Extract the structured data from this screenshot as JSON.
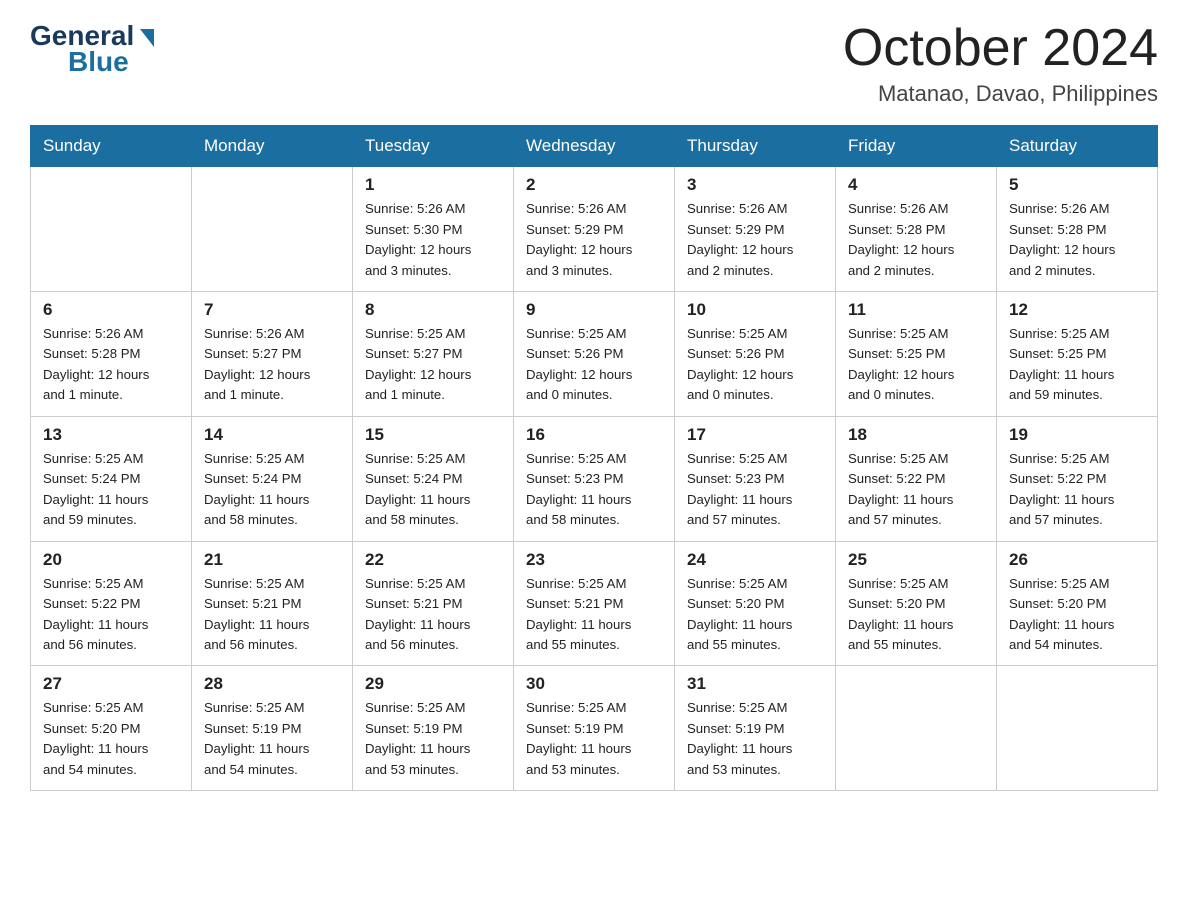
{
  "header": {
    "logo": {
      "general": "General",
      "blue": "Blue"
    },
    "title": "October 2024",
    "location": "Matanao, Davao, Philippines"
  },
  "weekdays": [
    "Sunday",
    "Monday",
    "Tuesday",
    "Wednesday",
    "Thursday",
    "Friday",
    "Saturday"
  ],
  "weeks": [
    [
      {
        "day": "",
        "info": ""
      },
      {
        "day": "",
        "info": ""
      },
      {
        "day": "1",
        "info": "Sunrise: 5:26 AM\nSunset: 5:30 PM\nDaylight: 12 hours\nand 3 minutes."
      },
      {
        "day": "2",
        "info": "Sunrise: 5:26 AM\nSunset: 5:29 PM\nDaylight: 12 hours\nand 3 minutes."
      },
      {
        "day": "3",
        "info": "Sunrise: 5:26 AM\nSunset: 5:29 PM\nDaylight: 12 hours\nand 2 minutes."
      },
      {
        "day": "4",
        "info": "Sunrise: 5:26 AM\nSunset: 5:28 PM\nDaylight: 12 hours\nand 2 minutes."
      },
      {
        "day": "5",
        "info": "Sunrise: 5:26 AM\nSunset: 5:28 PM\nDaylight: 12 hours\nand 2 minutes."
      }
    ],
    [
      {
        "day": "6",
        "info": "Sunrise: 5:26 AM\nSunset: 5:28 PM\nDaylight: 12 hours\nand 1 minute."
      },
      {
        "day": "7",
        "info": "Sunrise: 5:26 AM\nSunset: 5:27 PM\nDaylight: 12 hours\nand 1 minute."
      },
      {
        "day": "8",
        "info": "Sunrise: 5:25 AM\nSunset: 5:27 PM\nDaylight: 12 hours\nand 1 minute."
      },
      {
        "day": "9",
        "info": "Sunrise: 5:25 AM\nSunset: 5:26 PM\nDaylight: 12 hours\nand 0 minutes."
      },
      {
        "day": "10",
        "info": "Sunrise: 5:25 AM\nSunset: 5:26 PM\nDaylight: 12 hours\nand 0 minutes."
      },
      {
        "day": "11",
        "info": "Sunrise: 5:25 AM\nSunset: 5:25 PM\nDaylight: 12 hours\nand 0 minutes."
      },
      {
        "day": "12",
        "info": "Sunrise: 5:25 AM\nSunset: 5:25 PM\nDaylight: 11 hours\nand 59 minutes."
      }
    ],
    [
      {
        "day": "13",
        "info": "Sunrise: 5:25 AM\nSunset: 5:24 PM\nDaylight: 11 hours\nand 59 minutes."
      },
      {
        "day": "14",
        "info": "Sunrise: 5:25 AM\nSunset: 5:24 PM\nDaylight: 11 hours\nand 58 minutes."
      },
      {
        "day": "15",
        "info": "Sunrise: 5:25 AM\nSunset: 5:24 PM\nDaylight: 11 hours\nand 58 minutes."
      },
      {
        "day": "16",
        "info": "Sunrise: 5:25 AM\nSunset: 5:23 PM\nDaylight: 11 hours\nand 58 minutes."
      },
      {
        "day": "17",
        "info": "Sunrise: 5:25 AM\nSunset: 5:23 PM\nDaylight: 11 hours\nand 57 minutes."
      },
      {
        "day": "18",
        "info": "Sunrise: 5:25 AM\nSunset: 5:22 PM\nDaylight: 11 hours\nand 57 minutes."
      },
      {
        "day": "19",
        "info": "Sunrise: 5:25 AM\nSunset: 5:22 PM\nDaylight: 11 hours\nand 57 minutes."
      }
    ],
    [
      {
        "day": "20",
        "info": "Sunrise: 5:25 AM\nSunset: 5:22 PM\nDaylight: 11 hours\nand 56 minutes."
      },
      {
        "day": "21",
        "info": "Sunrise: 5:25 AM\nSunset: 5:21 PM\nDaylight: 11 hours\nand 56 minutes."
      },
      {
        "day": "22",
        "info": "Sunrise: 5:25 AM\nSunset: 5:21 PM\nDaylight: 11 hours\nand 56 minutes."
      },
      {
        "day": "23",
        "info": "Sunrise: 5:25 AM\nSunset: 5:21 PM\nDaylight: 11 hours\nand 55 minutes."
      },
      {
        "day": "24",
        "info": "Sunrise: 5:25 AM\nSunset: 5:20 PM\nDaylight: 11 hours\nand 55 minutes."
      },
      {
        "day": "25",
        "info": "Sunrise: 5:25 AM\nSunset: 5:20 PM\nDaylight: 11 hours\nand 55 minutes."
      },
      {
        "day": "26",
        "info": "Sunrise: 5:25 AM\nSunset: 5:20 PM\nDaylight: 11 hours\nand 54 minutes."
      }
    ],
    [
      {
        "day": "27",
        "info": "Sunrise: 5:25 AM\nSunset: 5:20 PM\nDaylight: 11 hours\nand 54 minutes."
      },
      {
        "day": "28",
        "info": "Sunrise: 5:25 AM\nSunset: 5:19 PM\nDaylight: 11 hours\nand 54 minutes."
      },
      {
        "day": "29",
        "info": "Sunrise: 5:25 AM\nSunset: 5:19 PM\nDaylight: 11 hours\nand 53 minutes."
      },
      {
        "day": "30",
        "info": "Sunrise: 5:25 AM\nSunset: 5:19 PM\nDaylight: 11 hours\nand 53 minutes."
      },
      {
        "day": "31",
        "info": "Sunrise: 5:25 AM\nSunset: 5:19 PM\nDaylight: 11 hours\nand 53 minutes."
      },
      {
        "day": "",
        "info": ""
      },
      {
        "day": "",
        "info": ""
      }
    ]
  ]
}
